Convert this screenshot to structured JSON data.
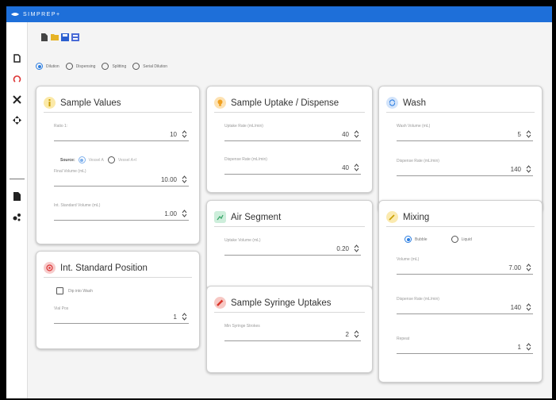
{
  "app": {
    "title": "SIMPREP+"
  },
  "sidebar": {
    "items": [
      {
        "icon": "new-file-icon"
      },
      {
        "icon": "loop-icon"
      },
      {
        "icon": "tools-icon"
      },
      {
        "icon": "move-icon"
      },
      {
        "icon": "document-icon"
      },
      {
        "icon": "molecule-icon"
      }
    ]
  },
  "toolbar": {
    "items": [
      "new-file-icon",
      "open-folder-icon",
      "save-icon",
      "save-all-icon"
    ]
  },
  "modes": [
    {
      "label": "Dilution",
      "selected": true
    },
    {
      "label": "Dispensing",
      "selected": false
    },
    {
      "label": "Splitting",
      "selected": false
    },
    {
      "label": "Serial Dilution",
      "selected": false
    }
  ],
  "sample_values": {
    "title": "Sample Values",
    "ratio_label": "Ratio 1:",
    "ratio_value": "10",
    "source_label": "Source:",
    "source_opt1": "Vessel A",
    "source_opt2": "Vessel A+I",
    "final_volume_label": "Final Volume (mL)",
    "final_volume_value": "10.00",
    "int_std_volume_label": "Int. Standard Volume (mL)",
    "int_std_volume_value": "1.00"
  },
  "int_standard_position": {
    "title": "Int. Standard Position",
    "dip_label": "Dip into Wash",
    "vial_label": "Vial Pos",
    "vial_value": "1"
  },
  "sample_uptake": {
    "title": "Sample Uptake / Dispense",
    "uptake_label": "Uptake Rate (mL/min)",
    "uptake_value": "40",
    "dispense_label": "Dispense Rate (mL/min)",
    "dispense_value": "40"
  },
  "air_segment": {
    "title": "Air Segment",
    "uptake_volume_label": "Uptake Volume (mL)",
    "uptake_volume_value": "0.20"
  },
  "syringe_uptakes": {
    "title": "Sample Syringe Uptakes",
    "min_label": "Min Syringe Strokes",
    "min_value": "2"
  },
  "wash": {
    "title": "Wash",
    "volume_label": "Wash Volume (mL)",
    "volume_value": "5",
    "dispense_label": "Dispense Rate (mL/min)",
    "dispense_value": "140"
  },
  "mixing": {
    "title": "Mixing",
    "opt_bubble": "Bubble",
    "opt_liquid": "Liquid",
    "volume_label": "Volume (mL)",
    "volume_value": "7.00",
    "dispense_label": "Dispense Rate (mL/min)",
    "dispense_value": "140",
    "repeat_label": "Repeat",
    "repeat_value": "1"
  },
  "colors": {
    "titlebar": "#1e6fd9",
    "accent": "#2a7de1",
    "sample": "#e3c12a",
    "uptake": "#f0a020",
    "wash": "#2a7de1",
    "air": "#3aa66a",
    "syringe": "#d9362b",
    "mixing": "#e7c33a",
    "intstd": "#d33"
  }
}
